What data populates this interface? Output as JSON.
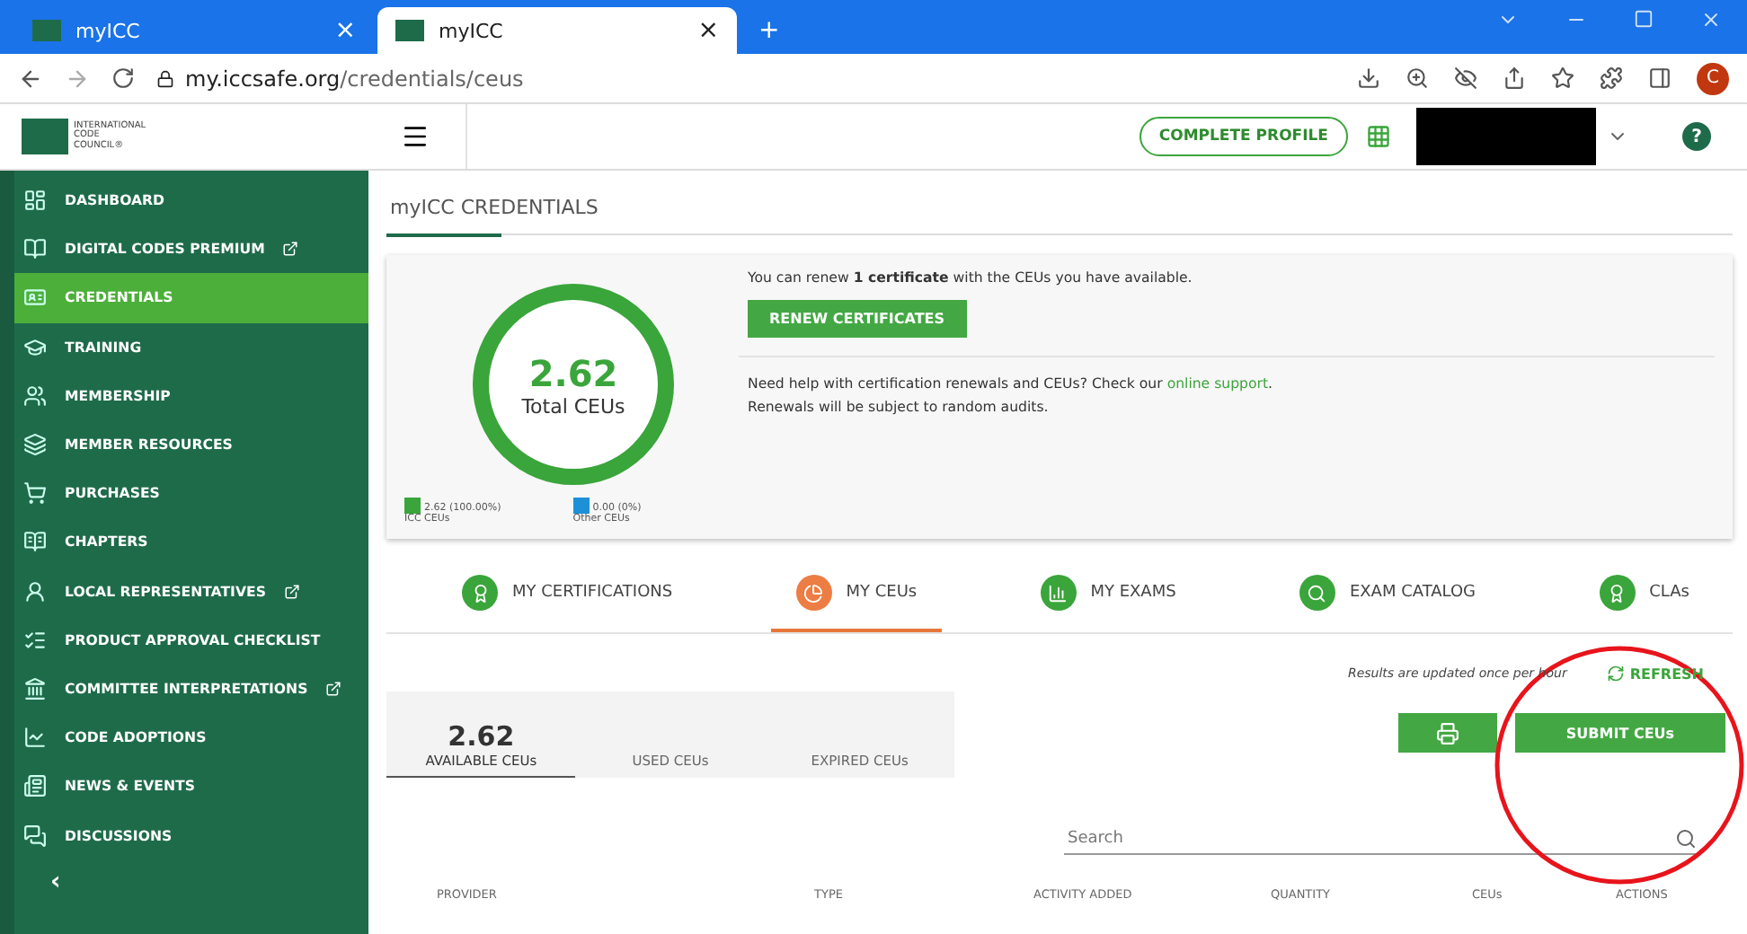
{
  "browser": {
    "tabs": [
      {
        "title": "myICC",
        "selected": false,
        "close": "×"
      },
      {
        "title": "myICC",
        "selected": true,
        "close": "×"
      }
    ],
    "new_tab": "+",
    "url": {
      "host": "my.iccsafe.org",
      "path": "/credentials/ceus"
    },
    "profile_initial": "C"
  },
  "header": {
    "logo_text": "INTERNATIONAL CODE COUNCIL®",
    "complete_profile": "COMPLETE PROFILE",
    "help": "?"
  },
  "sidebar": {
    "items": [
      {
        "label": "DASHBOARD",
        "external": false,
        "selected": false
      },
      {
        "label": "DIGITAL CODES PREMIUM",
        "external": true,
        "selected": false
      },
      {
        "label": "CREDENTIALS",
        "external": false,
        "selected": true
      },
      {
        "label": "TRAINING",
        "external": false,
        "selected": false
      },
      {
        "label": "MEMBERSHIP",
        "external": false,
        "selected": false
      },
      {
        "label": "MEMBER RESOURCES",
        "external": false,
        "selected": false
      },
      {
        "label": "PURCHASES",
        "external": false,
        "selected": false
      },
      {
        "label": "CHAPTERS",
        "external": false,
        "selected": false
      },
      {
        "label": "LOCAL REPRESENTATIVES",
        "external": true,
        "selected": false
      },
      {
        "label": "PRODUCT APPROVAL CHECKLIST",
        "external": false,
        "selected": false
      },
      {
        "label": "COMMITTEE INTERPRETATIONS",
        "external": true,
        "selected": false
      },
      {
        "label": "CODE ADOPTIONS",
        "external": false,
        "selected": false
      },
      {
        "label": "NEWS & EVENTS",
        "external": false,
        "selected": false
      },
      {
        "label": "DISCUSSIONS",
        "external": false,
        "selected": false
      }
    ],
    "collapse": "‹"
  },
  "page_title": "myICC CREDENTIALS",
  "summary": {
    "total": "2.62",
    "total_label": "Total CEUs",
    "legend": [
      {
        "value": "2.62 (100.00%)",
        "label": "ICC CEUs",
        "color": "#3aa53a"
      },
      {
        "value": "0.00 (0%)",
        "label": "Other CEUs",
        "color": "#1e90d8"
      }
    ],
    "renew_text": "You can renew **1 certificate** with the CEUs you have available.",
    "renew_button": "RENEW CERTIFICATES",
    "help_text": "Need help with certification renewals and CEUs? Check our",
    "help_link": "online support",
    "help_end": ".",
    "audit_text": "Renewals will be subject to random audits."
  },
  "tabs": [
    {
      "label": "MY CERTIFICATIONS",
      "selected": false
    },
    {
      "label": "MY CEUs",
      "selected": true
    },
    {
      "label": "MY EXAMS",
      "selected": false
    },
    {
      "label": "EXAM CATALOG",
      "selected": false
    },
    {
      "label": "CLAs",
      "selected": false
    }
  ],
  "update_note": "Results are updated once per hour",
  "refresh": "REFRESH",
  "ceu_tabs": [
    {
      "value": "2.62",
      "label": "AVAILABLE CEUs",
      "selected": true
    },
    {
      "label": "USED CEUs",
      "selected": false
    },
    {
      "label": "EXPIRED CEUs",
      "selected": false
    }
  ],
  "submit": "SUBMIT CEUs",
  "search": {
    "placeholder": "Search"
  },
  "table": {
    "columns": [
      "PROVIDER",
      "TYPE",
      "ACTIVITY ADDED",
      "QUANTITY",
      "CEUs",
      "ACTIONS"
    ]
  }
}
